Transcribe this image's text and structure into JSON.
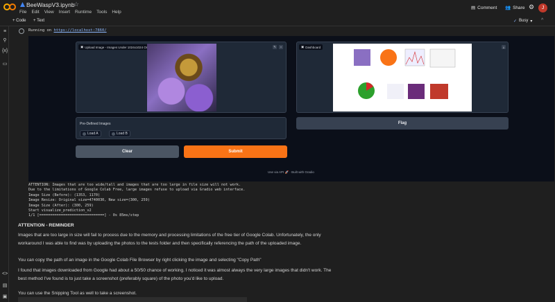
{
  "app": {
    "notebook_title": "BeeWaspV3.ipynb",
    "menu": [
      "File",
      "Edit",
      "View",
      "Insert",
      "Runtime",
      "Tools",
      "Help"
    ],
    "comment_label": "Comment",
    "share_label": "Share",
    "avatar_letter": "J"
  },
  "toolbar": {
    "code_label": "+ Code",
    "text_label": "+ Text",
    "status_label": "Busy"
  },
  "cell": {
    "running_prefix": "Running on ",
    "running_url": "https://localhost:7860/"
  },
  "gradio": {
    "upload_label": "Upload Image - Images Under 1024x1024 Only",
    "dashboard_label": "Dashboard",
    "predefined_title": "Pre-Defined Images",
    "radio_options": [
      "Load A",
      "Load B"
    ],
    "clear_label": "Clear",
    "submit_label": "Submit",
    "flag_label": "Flag",
    "footer_api": "Use via API",
    "footer_gradio": "Built with Gradio",
    "colors": {
      "submit": "#f97316",
      "clear": "#4b5563",
      "flag": "#374151"
    }
  },
  "output_log": [
    "ATTENTION: Images that are too wide/tall and images that are too large in file size will not work.",
    "Due to the limitations of Google Colab Free, large images refuse to upload via Gradio web interface.",
    "Image Size (Before): (1353, 1170)",
    "Image Resize: Original size=4740030, New size=(300, 259)",
    "Image Size (After): (300, 259)",
    "Start visualize_prediction_v2",
    "1/1 [==============================] - 0s 85ms/step"
  ],
  "markdown": {
    "heading": "ATTENTION - REMINDER",
    "p1": "Images that are too large in size will fail to process due to the memory and processing limitations of the free tier of Google Colab. Unfortunately, the only workaround I was able to find was by uploading the photos to the tests folder and then specifically referencing the path of the uploaded image.",
    "p2": "You can copy the path of an image in the Google Colab File Browser by right clicking the image and selecting \"Copy Path\"",
    "p3": "I found that images downloaded from Google had about a 50/50 chance of working. I noticed it was almost always the very large images that didn't work. The best method I've found is to just take a screenshot (preferably square) of the photo you'd like to upload.",
    "p4": "You can use the Snipping Tool as well to take a screenshot."
  },
  "icons": {
    "rail": [
      "menu-icon",
      "search-icon",
      "variables-icon",
      "folder-icon"
    ],
    "rail_bottom": [
      "code-icon",
      "terminal-icon",
      "command-icon"
    ]
  }
}
